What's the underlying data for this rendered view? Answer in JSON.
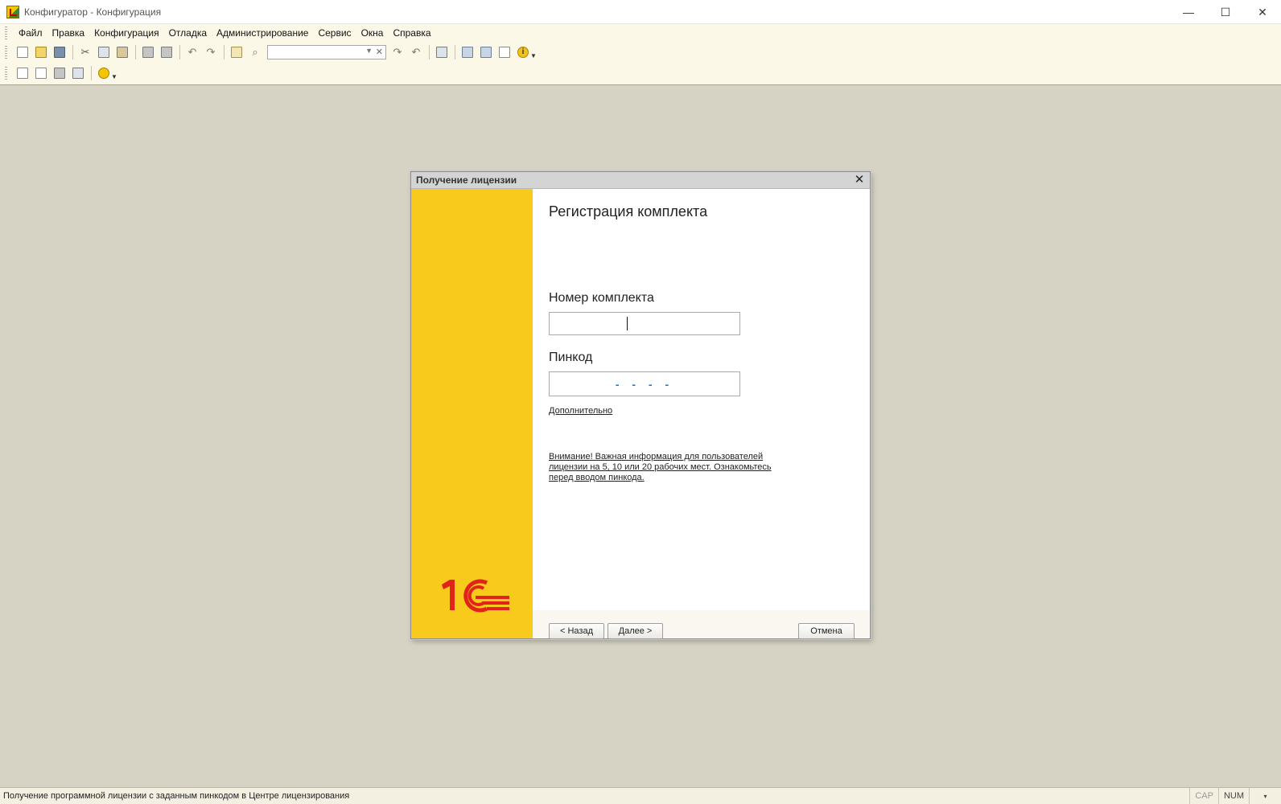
{
  "window": {
    "title": "Конфигуратор - Конфигурация",
    "controls": [
      "—",
      "☐",
      "✕"
    ]
  },
  "menu": [
    "Файл",
    "Правка",
    "Конфигурация",
    "Отладка",
    "Администрирование",
    "Сервис",
    "Окна",
    "Справка"
  ],
  "toolbar": {
    "search_value": ""
  },
  "dialog": {
    "title": "Получение лицензии",
    "close": "✕",
    "heading": "Регистрация комплекта",
    "kit_label": "Номер комплекта",
    "kit_value": "",
    "pin_label": "Пинкод",
    "pin_value": "- - - -",
    "more_link": "Дополнительно",
    "notice_link": "Внимание! Важная информация для пользователей лицензии на 5, 10 или 20 рабочих мест. Ознакомьтесь перед вводом пинкода.",
    "back_button": "< Назад",
    "next_button": "Далее >",
    "cancel_button": "Отмена",
    "brand_color": "#f8ca1b",
    "logo_color": "#e2231a"
  },
  "status": {
    "text": "Получение программной лицензии с заданным пинкодом в Центре лицензирования",
    "cap": "CAP",
    "num": "NUM",
    "drop": "▾"
  }
}
